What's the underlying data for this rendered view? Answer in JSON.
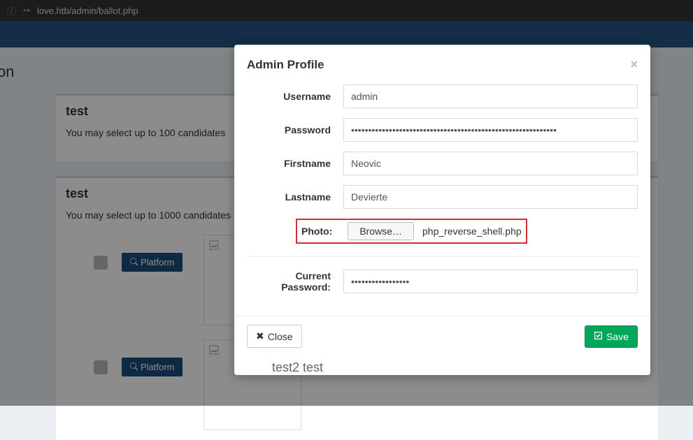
{
  "browser": {
    "url": "love.htb/admin/ballot.php"
  },
  "page": {
    "title": "t Position"
  },
  "sections": [
    {
      "title": "test",
      "subtitle": "You may select up to 100 candidates",
      "platform_label": "Platform"
    },
    {
      "title": "test",
      "subtitle": "You may select up to 1000 candidates",
      "platform_label": "Platform"
    }
  ],
  "modal": {
    "title": "Admin Profile",
    "labels": {
      "username": "Username",
      "password": "Password",
      "firstname": "Firstname",
      "lastname": "Lastname",
      "photo": "Photo:",
      "browse": "Browse…",
      "current_password": "Current Password:"
    },
    "values": {
      "username": "admin",
      "password": "••••••••••••••••••••••••••••••••••••••••••••••••••••••••••••",
      "firstname": "Neovic",
      "lastname": "Devierte",
      "file": "php_reverse_shell.php",
      "current_password": "•••••••••••••••••"
    },
    "footer": {
      "close": "Close",
      "save": "Save"
    }
  },
  "behind": {
    "row_label": "test2 test"
  }
}
